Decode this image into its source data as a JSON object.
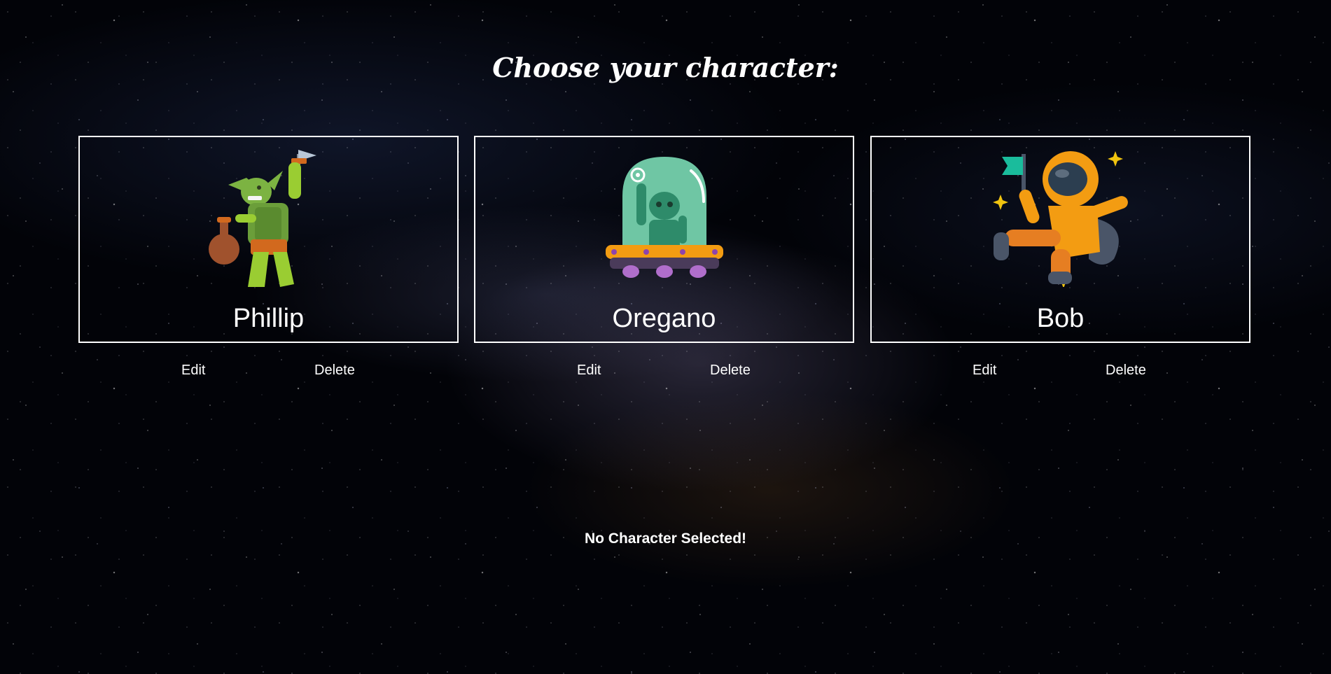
{
  "page": {
    "title": "Choose your character:",
    "status": "No Character Selected!"
  },
  "characters": [
    {
      "name": "Phillip",
      "avatar_icon": "goblin-icon",
      "edit_label": "Edit",
      "delete_label": "Delete"
    },
    {
      "name": "Oregano",
      "avatar_icon": "alien-ufo-icon",
      "edit_label": "Edit",
      "delete_label": "Delete"
    },
    {
      "name": "Bob",
      "avatar_icon": "astronaut-icon",
      "edit_label": "Edit",
      "delete_label": "Delete"
    }
  ],
  "colors": {
    "background": "#020308",
    "text": "#ffffff",
    "card_border": "#ffffff"
  }
}
